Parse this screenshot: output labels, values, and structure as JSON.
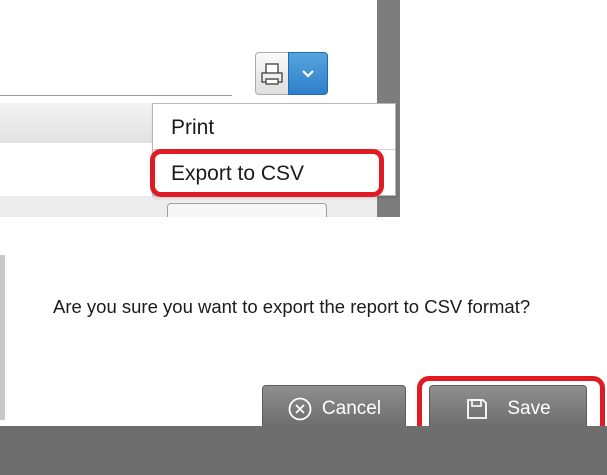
{
  "toolbar": {
    "print_button": {
      "icon": "printer-icon"
    },
    "dropdown_button": {
      "icon": "chevron-down-icon",
      "color": "#3b8bd3"
    }
  },
  "dropdown": {
    "items": [
      {
        "label": "Print"
      },
      {
        "label": "Export to CSV"
      }
    ],
    "highlight_color": "#e11b24"
  },
  "dialog": {
    "message": "Are you sure you want to export the report to CSV format?",
    "cancel_label": "Cancel",
    "cancel_icon": "circle-x-icon",
    "save_label": "Save",
    "save_icon": "floppy-disk-icon",
    "button_color": "#7b7b7b"
  }
}
